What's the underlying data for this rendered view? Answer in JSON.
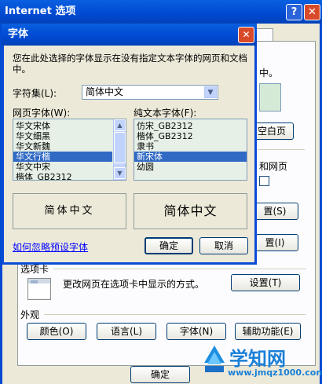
{
  "outer": {
    "title": "Internet 选项",
    "help_glyph": "?",
    "close_glyph": "✕",
    "partial_texts": [
      "中。",
      "空白页",
      "和网页",
      "置(S)",
      "置(I)"
    ],
    "tabs_section": {
      "label": "选项卡",
      "description": "更改网页在选项卡中显示的方式。",
      "settings_button": "设置(T)"
    },
    "appearance": {
      "label": "外观",
      "buttons": [
        "颜色(O)",
        "语言(L)",
        "字体(N)",
        "辅助功能(E)"
      ]
    },
    "ok_button": "确定"
  },
  "dialog": {
    "title": "字体",
    "close_glyph": "✕",
    "description": "您在此处选择的字体显示在没有指定文本字体的网页和文档中。",
    "charset_label": "字符集(L):",
    "charset_value": "简体中文",
    "webfont_label": "网页字体(W):",
    "plainfont_label": "纯文本字体(F):",
    "webfont_items": [
      {
        "text": "华文宋体",
        "selected": false
      },
      {
        "text": "华文细黑",
        "selected": false
      },
      {
        "text": "华文新魏",
        "selected": false
      },
      {
        "text": "华文行楷",
        "selected": true
      },
      {
        "text": "华文中宋",
        "selected": false
      },
      {
        "text": "楷体_GB2312",
        "selected": false
      }
    ],
    "plainfont_items": [
      {
        "text": "仿宋_GB2312",
        "selected": false
      },
      {
        "text": "楷体_GB2312",
        "selected": false
      },
      {
        "text": "隶书",
        "selected": false
      },
      {
        "text": "新宋体",
        "selected": true
      },
      {
        "text": "幼圆",
        "selected": false
      }
    ],
    "preview_web": "简体中文",
    "preview_plain": "简体中文",
    "ignore_link": "如何忽略预设字体",
    "ok_button": "确定",
    "cancel_button": "取消"
  },
  "watermark": {
    "brand": "学知网",
    "url": "www.jmqz1000.com"
  }
}
